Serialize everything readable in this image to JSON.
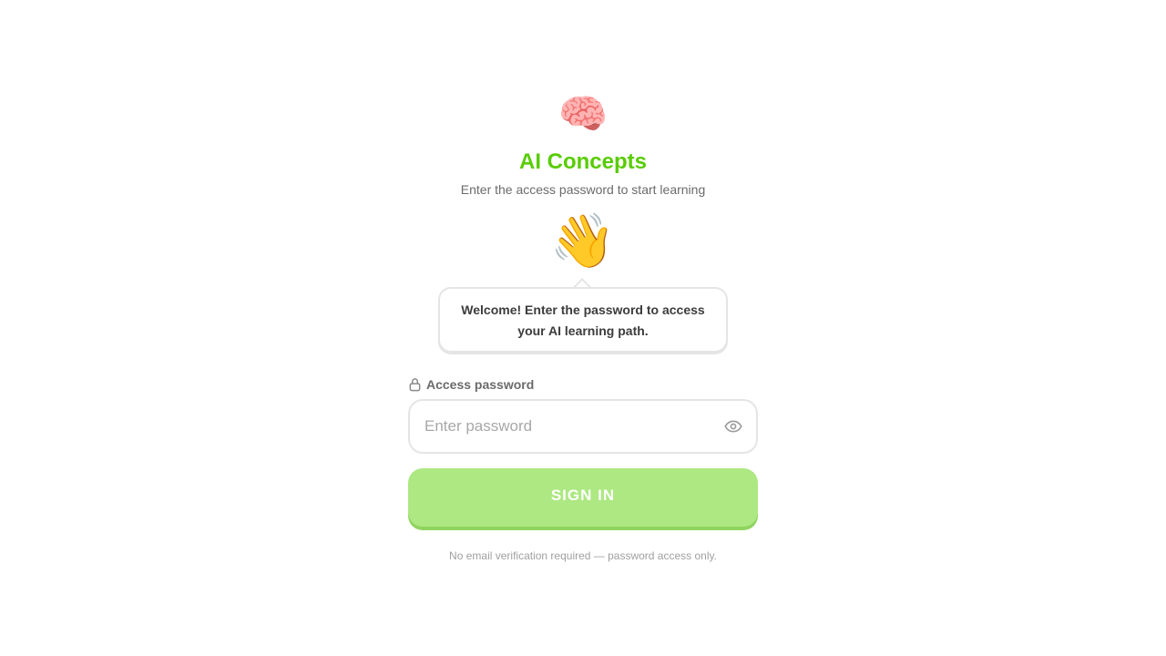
{
  "colors": {
    "accent": "#58cc02",
    "button_bg": "#ade882",
    "button_shadow": "#8fd45f"
  },
  "header": {
    "logo_emoji": "🧠",
    "title": "AI Concepts",
    "subtitle": "Enter the access password to start learning"
  },
  "mascot": {
    "emoji": "👋",
    "bubble_text": "Welcome! Enter the password to access your AI learning path."
  },
  "form": {
    "label": "Access password",
    "label_icon": "lock-icon",
    "password_value": "",
    "password_placeholder": "Enter password",
    "toggle_icon": "eye-icon",
    "submit_label": "SIGN IN",
    "footnote": "No email verification required — password access only."
  }
}
